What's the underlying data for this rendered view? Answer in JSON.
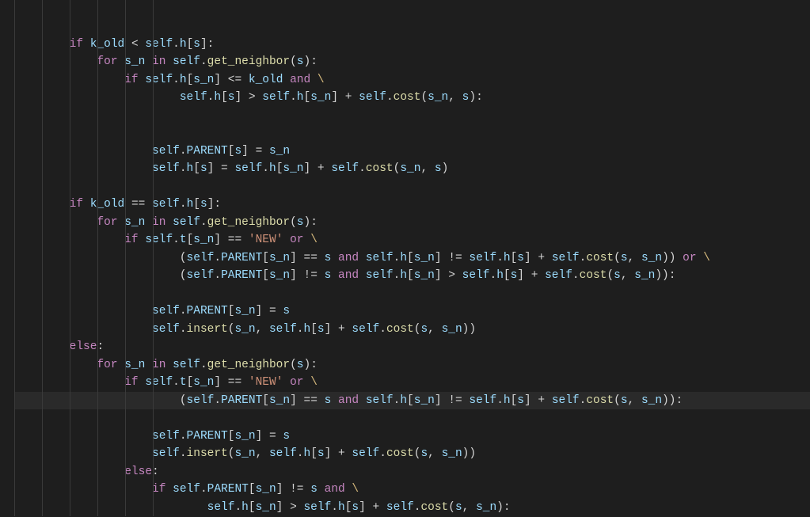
{
  "code_lines": [
    {
      "indent": 2,
      "hl": false,
      "tokens": [
        [
          "kw",
          "if"
        ],
        [
          "op",
          " "
        ],
        [
          "var",
          "k_old"
        ],
        [
          "op",
          " < "
        ],
        [
          "self",
          "self"
        ],
        [
          "op",
          "."
        ],
        [
          "mem",
          "h"
        ],
        [
          "op",
          "["
        ],
        [
          "var",
          "s"
        ],
        [
          "op",
          "]:"
        ]
      ]
    },
    {
      "indent": 3,
      "hl": false,
      "tokens": [
        [
          "kw",
          "for"
        ],
        [
          "op",
          " "
        ],
        [
          "var",
          "s_n"
        ],
        [
          "op",
          " "
        ],
        [
          "kw",
          "in"
        ],
        [
          "op",
          " "
        ],
        [
          "self",
          "self"
        ],
        [
          "op",
          "."
        ],
        [
          "fn",
          "get_neighbor"
        ],
        [
          "op",
          "("
        ],
        [
          "var",
          "s"
        ],
        [
          "op",
          "):"
        ]
      ]
    },
    {
      "indent": 4,
      "hl": false,
      "tokens": [
        [
          "kw",
          "if"
        ],
        [
          "op",
          " "
        ],
        [
          "self",
          "self"
        ],
        [
          "op",
          "."
        ],
        [
          "mem",
          "h"
        ],
        [
          "op",
          "["
        ],
        [
          "var",
          "s_n"
        ],
        [
          "op",
          "] <= "
        ],
        [
          "var",
          "k_old"
        ],
        [
          "op",
          " "
        ],
        [
          "kw",
          "and"
        ],
        [
          "op",
          " "
        ],
        [
          "esc",
          "\\"
        ]
      ]
    },
    {
      "indent": 6,
      "hl": false,
      "tokens": [
        [
          "self",
          "self"
        ],
        [
          "op",
          "."
        ],
        [
          "mem",
          "h"
        ],
        [
          "op",
          "["
        ],
        [
          "var",
          "s"
        ],
        [
          "op",
          "] > "
        ],
        [
          "self",
          "self"
        ],
        [
          "op",
          "."
        ],
        [
          "mem",
          "h"
        ],
        [
          "op",
          "["
        ],
        [
          "var",
          "s_n"
        ],
        [
          "op",
          "] + "
        ],
        [
          "self",
          "self"
        ],
        [
          "op",
          "."
        ],
        [
          "fn",
          "cost"
        ],
        [
          "op",
          "("
        ],
        [
          "var",
          "s_n"
        ],
        [
          "op",
          ", "
        ],
        [
          "var",
          "s"
        ],
        [
          "op",
          "):"
        ]
      ]
    },
    {
      "indent": 0,
      "hl": false,
      "tokens": []
    },
    {
      "indent": 0,
      "hl": false,
      "tokens": []
    },
    {
      "indent": 5,
      "hl": false,
      "tokens": [
        [
          "self",
          "self"
        ],
        [
          "op",
          "."
        ],
        [
          "mem",
          "PARENT"
        ],
        [
          "op",
          "["
        ],
        [
          "var",
          "s"
        ],
        [
          "op",
          "] = "
        ],
        [
          "var",
          "s_n"
        ]
      ]
    },
    {
      "indent": 5,
      "hl": false,
      "tokens": [
        [
          "self",
          "self"
        ],
        [
          "op",
          "."
        ],
        [
          "mem",
          "h"
        ],
        [
          "op",
          "["
        ],
        [
          "var",
          "s"
        ],
        [
          "op",
          "] = "
        ],
        [
          "self",
          "self"
        ],
        [
          "op",
          "."
        ],
        [
          "mem",
          "h"
        ],
        [
          "op",
          "["
        ],
        [
          "var",
          "s_n"
        ],
        [
          "op",
          "] + "
        ],
        [
          "self",
          "self"
        ],
        [
          "op",
          "."
        ],
        [
          "fn",
          "cost"
        ],
        [
          "op",
          "("
        ],
        [
          "var",
          "s_n"
        ],
        [
          "op",
          ", "
        ],
        [
          "var",
          "s"
        ],
        [
          "op",
          ")"
        ]
      ]
    },
    {
      "indent": 0,
      "hl": false,
      "tokens": []
    },
    {
      "indent": 2,
      "hl": false,
      "tokens": [
        [
          "kw",
          "if"
        ],
        [
          "op",
          " "
        ],
        [
          "var",
          "k_old"
        ],
        [
          "op",
          " == "
        ],
        [
          "self",
          "self"
        ],
        [
          "op",
          "."
        ],
        [
          "mem",
          "h"
        ],
        [
          "op",
          "["
        ],
        [
          "var",
          "s"
        ],
        [
          "op",
          "]:"
        ]
      ]
    },
    {
      "indent": 3,
      "hl": false,
      "tokens": [
        [
          "kw",
          "for"
        ],
        [
          "op",
          " "
        ],
        [
          "var",
          "s_n"
        ],
        [
          "op",
          " "
        ],
        [
          "kw",
          "in"
        ],
        [
          "op",
          " "
        ],
        [
          "self",
          "self"
        ],
        [
          "op",
          "."
        ],
        [
          "fn",
          "get_neighbor"
        ],
        [
          "op",
          "("
        ],
        [
          "var",
          "s"
        ],
        [
          "op",
          "):"
        ]
      ]
    },
    {
      "indent": 4,
      "hl": false,
      "tokens": [
        [
          "kw",
          "if"
        ],
        [
          "op",
          " "
        ],
        [
          "self",
          "self"
        ],
        [
          "op",
          "."
        ],
        [
          "mem",
          "t"
        ],
        [
          "op",
          "["
        ],
        [
          "var",
          "s_n"
        ],
        [
          "op",
          "] == "
        ],
        [
          "str",
          "'NEW'"
        ],
        [
          "op",
          " "
        ],
        [
          "kw",
          "or"
        ],
        [
          "op",
          " "
        ],
        [
          "esc",
          "\\"
        ]
      ]
    },
    {
      "indent": 6,
      "hl": false,
      "tokens": [
        [
          "op",
          "("
        ],
        [
          "self",
          "self"
        ],
        [
          "op",
          "."
        ],
        [
          "mem",
          "PARENT"
        ],
        [
          "op",
          "["
        ],
        [
          "var",
          "s_n"
        ],
        [
          "op",
          "] == "
        ],
        [
          "var",
          "s"
        ],
        [
          "op",
          " "
        ],
        [
          "kw",
          "and"
        ],
        [
          "op",
          " "
        ],
        [
          "self",
          "self"
        ],
        [
          "op",
          "."
        ],
        [
          "mem",
          "h"
        ],
        [
          "op",
          "["
        ],
        [
          "var",
          "s_n"
        ],
        [
          "op",
          "] != "
        ],
        [
          "self",
          "self"
        ],
        [
          "op",
          "."
        ],
        [
          "mem",
          "h"
        ],
        [
          "op",
          "["
        ],
        [
          "var",
          "s"
        ],
        [
          "op",
          "] + "
        ],
        [
          "self",
          "self"
        ],
        [
          "op",
          "."
        ],
        [
          "fn",
          "cost"
        ],
        [
          "op",
          "("
        ],
        [
          "var",
          "s"
        ],
        [
          "op",
          ", "
        ],
        [
          "var",
          "s_n"
        ],
        [
          "op",
          ")) "
        ],
        [
          "kw",
          "or"
        ],
        [
          "op",
          " "
        ],
        [
          "esc",
          "\\"
        ]
      ]
    },
    {
      "indent": 6,
      "hl": false,
      "tokens": [
        [
          "op",
          "("
        ],
        [
          "self",
          "self"
        ],
        [
          "op",
          "."
        ],
        [
          "mem",
          "PARENT"
        ],
        [
          "op",
          "["
        ],
        [
          "var",
          "s_n"
        ],
        [
          "op",
          "] != "
        ],
        [
          "var",
          "s"
        ],
        [
          "op",
          " "
        ],
        [
          "kw",
          "and"
        ],
        [
          "op",
          " "
        ],
        [
          "self",
          "self"
        ],
        [
          "op",
          "."
        ],
        [
          "mem",
          "h"
        ],
        [
          "op",
          "["
        ],
        [
          "var",
          "s_n"
        ],
        [
          "op",
          "] > "
        ],
        [
          "self",
          "self"
        ],
        [
          "op",
          "."
        ],
        [
          "mem",
          "h"
        ],
        [
          "op",
          "["
        ],
        [
          "var",
          "s"
        ],
        [
          "op",
          "] + "
        ],
        [
          "self",
          "self"
        ],
        [
          "op",
          "."
        ],
        [
          "fn",
          "cost"
        ],
        [
          "op",
          "("
        ],
        [
          "var",
          "s"
        ],
        [
          "op",
          ", "
        ],
        [
          "var",
          "s_n"
        ],
        [
          "op",
          ")):"
        ]
      ]
    },
    {
      "indent": 0,
      "hl": false,
      "tokens": []
    },
    {
      "indent": 5,
      "hl": false,
      "tokens": [
        [
          "self",
          "self"
        ],
        [
          "op",
          "."
        ],
        [
          "mem",
          "PARENT"
        ],
        [
          "op",
          "["
        ],
        [
          "var",
          "s_n"
        ],
        [
          "op",
          "] = "
        ],
        [
          "var",
          "s"
        ]
      ]
    },
    {
      "indent": 5,
      "hl": false,
      "tokens": [
        [
          "self",
          "self"
        ],
        [
          "op",
          "."
        ],
        [
          "fn",
          "insert"
        ],
        [
          "op",
          "("
        ],
        [
          "var",
          "s_n"
        ],
        [
          "op",
          ", "
        ],
        [
          "self",
          "self"
        ],
        [
          "op",
          "."
        ],
        [
          "mem",
          "h"
        ],
        [
          "op",
          "["
        ],
        [
          "var",
          "s"
        ],
        [
          "op",
          "] + "
        ],
        [
          "self",
          "self"
        ],
        [
          "op",
          "."
        ],
        [
          "fn",
          "cost"
        ],
        [
          "op",
          "("
        ],
        [
          "var",
          "s"
        ],
        [
          "op",
          ", "
        ],
        [
          "var",
          "s_n"
        ],
        [
          "op",
          "))"
        ]
      ]
    },
    {
      "indent": 2,
      "hl": false,
      "tokens": [
        [
          "kw",
          "else"
        ],
        [
          "op",
          ":"
        ]
      ]
    },
    {
      "indent": 3,
      "hl": false,
      "tokens": [
        [
          "kw",
          "for"
        ],
        [
          "op",
          " "
        ],
        [
          "var",
          "s_n"
        ],
        [
          "op",
          " "
        ],
        [
          "kw",
          "in"
        ],
        [
          "op",
          " "
        ],
        [
          "self",
          "self"
        ],
        [
          "op",
          "."
        ],
        [
          "fn",
          "get_neighbor"
        ],
        [
          "op",
          "("
        ],
        [
          "var",
          "s"
        ],
        [
          "op",
          "):"
        ]
      ]
    },
    {
      "indent": 4,
      "hl": false,
      "tokens": [
        [
          "kw",
          "if"
        ],
        [
          "op",
          " "
        ],
        [
          "self",
          "self"
        ],
        [
          "op",
          "."
        ],
        [
          "mem",
          "t"
        ],
        [
          "op",
          "["
        ],
        [
          "var",
          "s_n"
        ],
        [
          "op",
          "] == "
        ],
        [
          "str",
          "'NEW'"
        ],
        [
          "op",
          " "
        ],
        [
          "kw",
          "or"
        ],
        [
          "op",
          " "
        ],
        [
          "esc",
          "\\"
        ]
      ]
    },
    {
      "indent": 6,
      "hl": true,
      "tokens": [
        [
          "op",
          "("
        ],
        [
          "self",
          "self"
        ],
        [
          "op",
          "."
        ],
        [
          "mem",
          "PARENT"
        ],
        [
          "op",
          "["
        ],
        [
          "var",
          "s_n"
        ],
        [
          "op",
          "] == "
        ],
        [
          "var",
          "s"
        ],
        [
          "op",
          " "
        ],
        [
          "kw",
          "and"
        ],
        [
          "op",
          " "
        ],
        [
          "self",
          "self"
        ],
        [
          "op",
          "."
        ],
        [
          "mem",
          "h"
        ],
        [
          "op",
          "["
        ],
        [
          "var",
          "s_n"
        ],
        [
          "op",
          "] != "
        ],
        [
          "self",
          "self"
        ],
        [
          "op",
          "."
        ],
        [
          "mem",
          "h"
        ],
        [
          "op",
          "["
        ],
        [
          "var",
          "s"
        ],
        [
          "op",
          "] + "
        ],
        [
          "self",
          "self"
        ],
        [
          "op",
          "."
        ],
        [
          "fn",
          "cost"
        ],
        [
          "op",
          "("
        ],
        [
          "var",
          "s"
        ],
        [
          "op",
          ", "
        ],
        [
          "var",
          "s_n"
        ],
        [
          "op",
          ")):"
        ]
      ]
    },
    {
      "indent": 0,
      "hl": false,
      "tokens": []
    },
    {
      "indent": 5,
      "hl": false,
      "tokens": [
        [
          "self",
          "self"
        ],
        [
          "op",
          "."
        ],
        [
          "mem",
          "PARENT"
        ],
        [
          "op",
          "["
        ],
        [
          "var",
          "s_n"
        ],
        [
          "op",
          "] = "
        ],
        [
          "var",
          "s"
        ]
      ]
    },
    {
      "indent": 5,
      "hl": false,
      "tokens": [
        [
          "self",
          "self"
        ],
        [
          "op",
          "."
        ],
        [
          "fn",
          "insert"
        ],
        [
          "op",
          "("
        ],
        [
          "var",
          "s_n"
        ],
        [
          "op",
          ", "
        ],
        [
          "self",
          "self"
        ],
        [
          "op",
          "."
        ],
        [
          "mem",
          "h"
        ],
        [
          "op",
          "["
        ],
        [
          "var",
          "s"
        ],
        [
          "op",
          "] + "
        ],
        [
          "self",
          "self"
        ],
        [
          "op",
          "."
        ],
        [
          "fn",
          "cost"
        ],
        [
          "op",
          "("
        ],
        [
          "var",
          "s"
        ],
        [
          "op",
          ", "
        ],
        [
          "var",
          "s_n"
        ],
        [
          "op",
          "))"
        ]
      ]
    },
    {
      "indent": 4,
      "hl": false,
      "tokens": [
        [
          "kw",
          "else"
        ],
        [
          "op",
          ":"
        ]
      ]
    },
    {
      "indent": 5,
      "hl": false,
      "tokens": [
        [
          "kw",
          "if"
        ],
        [
          "op",
          " "
        ],
        [
          "self",
          "self"
        ],
        [
          "op",
          "."
        ],
        [
          "mem",
          "PARENT"
        ],
        [
          "op",
          "["
        ],
        [
          "var",
          "s_n"
        ],
        [
          "op",
          "] != "
        ],
        [
          "var",
          "s"
        ],
        [
          "op",
          " "
        ],
        [
          "kw",
          "and"
        ],
        [
          "op",
          " "
        ],
        [
          "esc",
          "\\"
        ]
      ]
    },
    {
      "indent": 7,
      "hl": false,
      "tokens": [
        [
          "self",
          "self"
        ],
        [
          "op",
          "."
        ],
        [
          "mem",
          "h"
        ],
        [
          "op",
          "["
        ],
        [
          "var",
          "s_n"
        ],
        [
          "op",
          "] > "
        ],
        [
          "self",
          "self"
        ],
        [
          "op",
          "."
        ],
        [
          "mem",
          "h"
        ],
        [
          "op",
          "["
        ],
        [
          "var",
          "s"
        ],
        [
          "op",
          "] + "
        ],
        [
          "self",
          "self"
        ],
        [
          "op",
          "."
        ],
        [
          "fn",
          "cost"
        ],
        [
          "op",
          "("
        ],
        [
          "var",
          "s"
        ],
        [
          "op",
          ", "
        ],
        [
          "var",
          "s_n"
        ],
        [
          "op",
          "):"
        ]
      ]
    }
  ],
  "indent_unit": "    ",
  "colors": {
    "background": "#1e1e1e",
    "keyword": "#c586c0",
    "identifier": "#9cdcfe",
    "function": "#dcdcaa",
    "string": "#ce9178",
    "default": "#d4d4d4",
    "escape": "#d7ba7d",
    "highlight_line": "#2a2a2a",
    "indent_guide": "#3a3a3a"
  }
}
